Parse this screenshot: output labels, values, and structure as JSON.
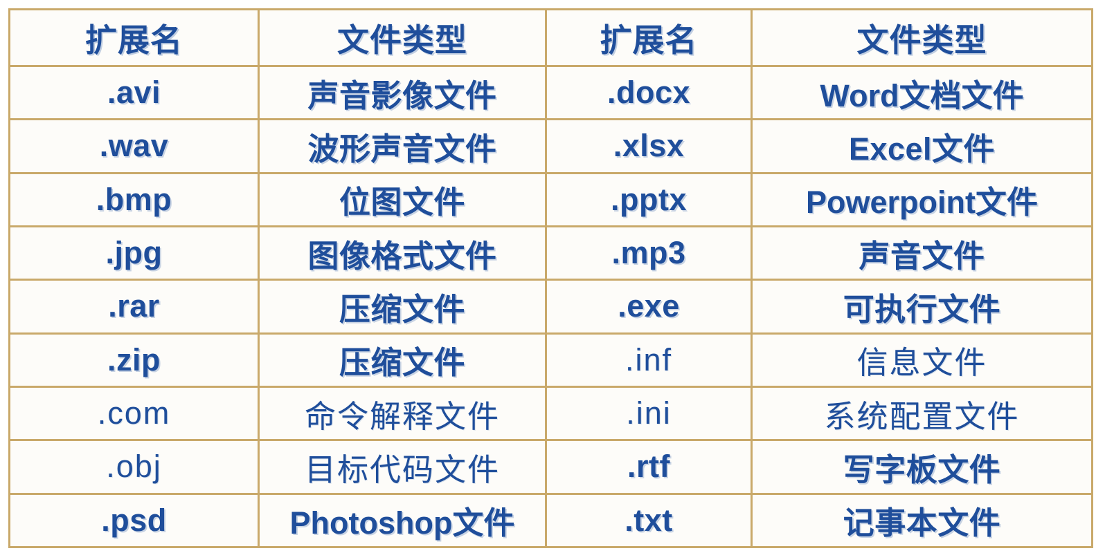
{
  "document": {
    "kind": "table",
    "language": "zh-CN",
    "colors": {
      "text": "#1f4e9b",
      "border": "#c9a96a",
      "cell_background": "#fdfcf9",
      "page_background": "#ffffff"
    }
  },
  "table": {
    "column_count": 4,
    "row_count": 11,
    "headers": [
      "扩展名",
      "文件类型",
      "扩展名",
      "文件类型"
    ],
    "rows": [
      [
        ".avi",
        "声音影像文件",
        ".docx",
        "Word文档文件"
      ],
      [
        ".wav",
        "波形声音文件",
        ".xlsx",
        "Excel文件"
      ],
      [
        ".bmp",
        "位图文件",
        ".pptx",
        "Powerpoint文件"
      ],
      [
        ".jpg",
        "图像格式文件",
        ".mp3",
        "声音文件"
      ],
      [
        ".rar",
        "压缩文件",
        ".exe",
        "可执行文件"
      ],
      [
        ".zip",
        "压缩文件",
        ".inf",
        "信息文件"
      ],
      [
        ".com",
        "命令解释文件",
        ".ini",
        "系统配置文件"
      ],
      [
        ".obj",
        "目标代码文件",
        ".rtf",
        "写字板文件"
      ],
      [
        ".psd",
        "Photoshop文件",
        ".txt",
        "记事本文件"
      ]
    ]
  }
}
